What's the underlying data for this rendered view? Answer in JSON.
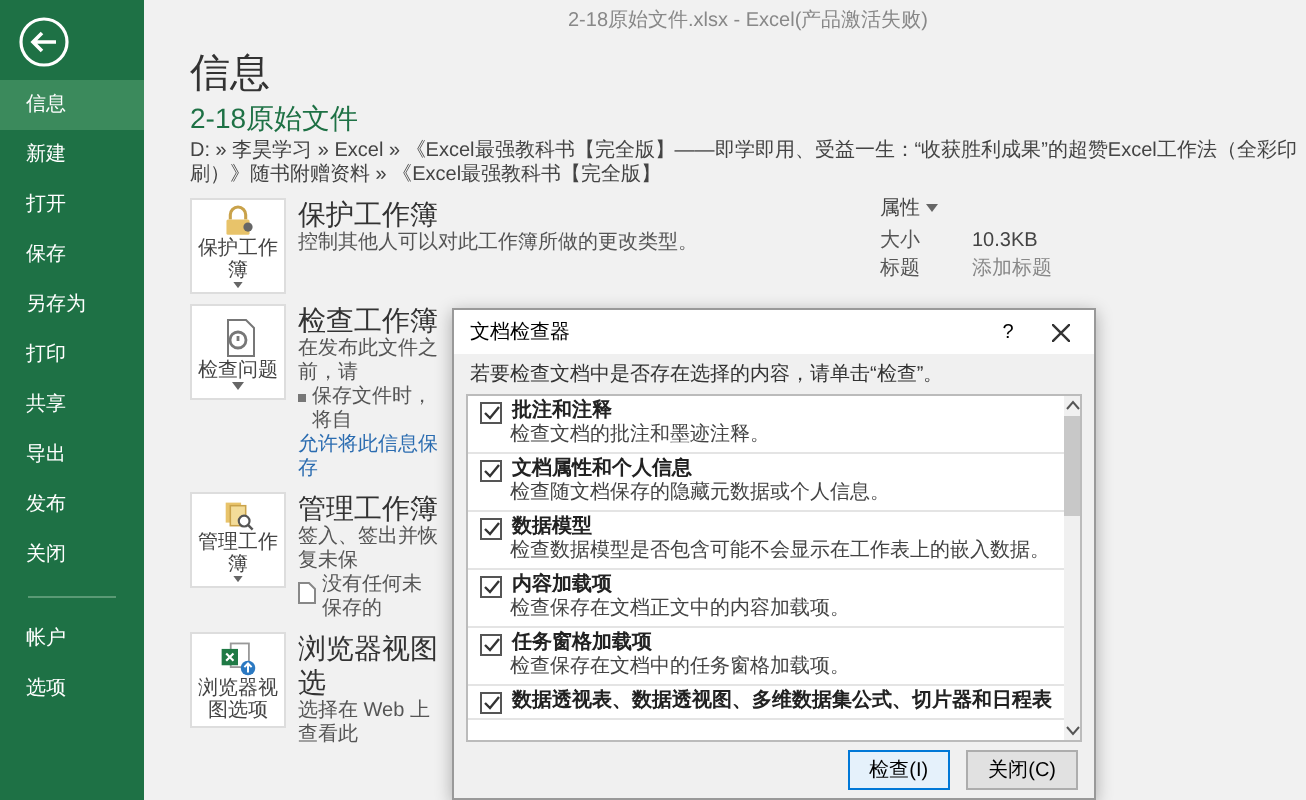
{
  "window": {
    "title": "2-18原始文件.xlsx - Excel(产品激活失败)"
  },
  "sidebar": {
    "items": [
      {
        "label": "信息",
        "selected": true
      },
      {
        "label": "新建",
        "selected": false
      },
      {
        "label": "打开",
        "selected": false
      },
      {
        "label": "保存",
        "selected": false
      },
      {
        "label": "另存为",
        "selected": false
      },
      {
        "label": "打印",
        "selected": false
      },
      {
        "label": "共享",
        "selected": false
      },
      {
        "label": "导出",
        "selected": false
      },
      {
        "label": "发布",
        "selected": false
      },
      {
        "label": "关闭",
        "selected": false
      }
    ],
    "footer_items": [
      {
        "label": "帐户",
        "selected": false
      },
      {
        "label": "选项",
        "selected": false
      }
    ]
  },
  "page": {
    "heading": "信息",
    "file_name": "2-18原始文件",
    "path": "D: » 李昊学习 » Excel » 《Excel最强教科书【完全版】——即学即用、受益一生：“收获胜利成果”的超赞Excel工作法（全彩印刷）》随书附赠资料 » 《Excel最强教科书【完全版】"
  },
  "sections": [
    {
      "kind": "protect",
      "button_label": "保护工作簿",
      "dropdown": true,
      "title": "保护工作簿",
      "lines": [
        {
          "kind": "text",
          "text": "控制其他人可以对此工作簿所做的更改类型。"
        }
      ]
    },
    {
      "kind": "inspect",
      "button_label": "检查问题",
      "dropdown": true,
      "title": "检查工作簿",
      "lines": [
        {
          "kind": "text",
          "text": "在发布此文件之前，请"
        },
        {
          "kind": "bullet",
          "text": "保存文件时，将自"
        },
        {
          "kind": "link",
          "text": "允许将此信息保存"
        }
      ]
    },
    {
      "kind": "manage",
      "button_label": "管理工作簿",
      "dropdown": true,
      "title": "管理工作簿",
      "lines": [
        {
          "kind": "text",
          "text": "签入、签出并恢复未保"
        },
        {
          "kind": "doc",
          "text": "没有任何未保存的"
        }
      ]
    },
    {
      "kind": "browser",
      "button_label": "浏览器视图选项",
      "dropdown": false,
      "title": "浏览器视图选",
      "lines": [
        {
          "kind": "text",
          "text": "选择在 Web 上查看此"
        }
      ]
    }
  ],
  "properties": {
    "title": "属性",
    "rows": [
      {
        "label": "大小",
        "value": "10.3KB",
        "kind": "value"
      },
      {
        "label": "标题",
        "value": "添加标题",
        "kind": "placeholder"
      }
    ]
  },
  "dialog": {
    "title": "文档检查器",
    "help": "?",
    "instruction": "若要检查文档中是否存在选择的内容，请单击“检查”。",
    "items": [
      {
        "title": "批注和注释",
        "description": "检查文档的批注和墨迹注释。",
        "checked": true
      },
      {
        "title": "文档属性和个人信息",
        "description": "检查随文档保存的隐藏元数据或个人信息。",
        "checked": true
      },
      {
        "title": "数据模型",
        "description": "检查数据模型是否包含可能不会显示在工作表上的嵌入数据。",
        "checked": true
      },
      {
        "title": "内容加载项",
        "description": "检查保存在文档正文中的内容加载项。",
        "checked": true
      },
      {
        "title": "任务窗格加载项",
        "description": "检查保存在文档中的任务窗格加载项。",
        "checked": true
      },
      {
        "title": "数据透视表、数据透视图、多维数据集公式、切片器和日程表",
        "checked": true
      }
    ],
    "buttons": [
      {
        "label": "检查(I)",
        "selected": true
      },
      {
        "label": "关闭(C)",
        "selected": false
      }
    ]
  }
}
